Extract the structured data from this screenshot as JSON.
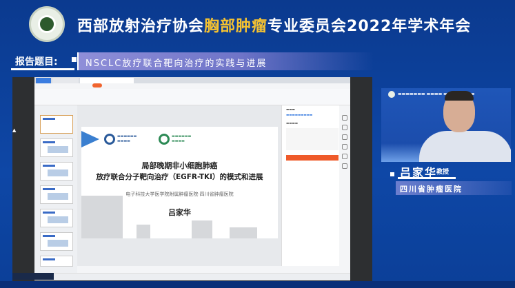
{
  "header": {
    "title_part1": "西部放射治疗协会",
    "title_highlight": "胸部肿瘤",
    "title_part2": "专业委员会2022年学术年会",
    "highlight_color": "#f5c231"
  },
  "topic": {
    "label": "报告题目:",
    "title": "NSCLC放疗联合靶向治疗的实践与进展"
  },
  "slide": {
    "title_line1": "局部晚期非小细胞肺癌",
    "title_line2": "放疗联合分子靶向治疗（EGFR-TKI）的模式和进展",
    "affiliation": "电子科技大学医学院附属肿瘤医院·四川省肿瘤医院",
    "presenter": "吕家华"
  },
  "speaker": {
    "name": "吕家华",
    "title": "教授",
    "hospital": "四川省肿瘤医院"
  }
}
